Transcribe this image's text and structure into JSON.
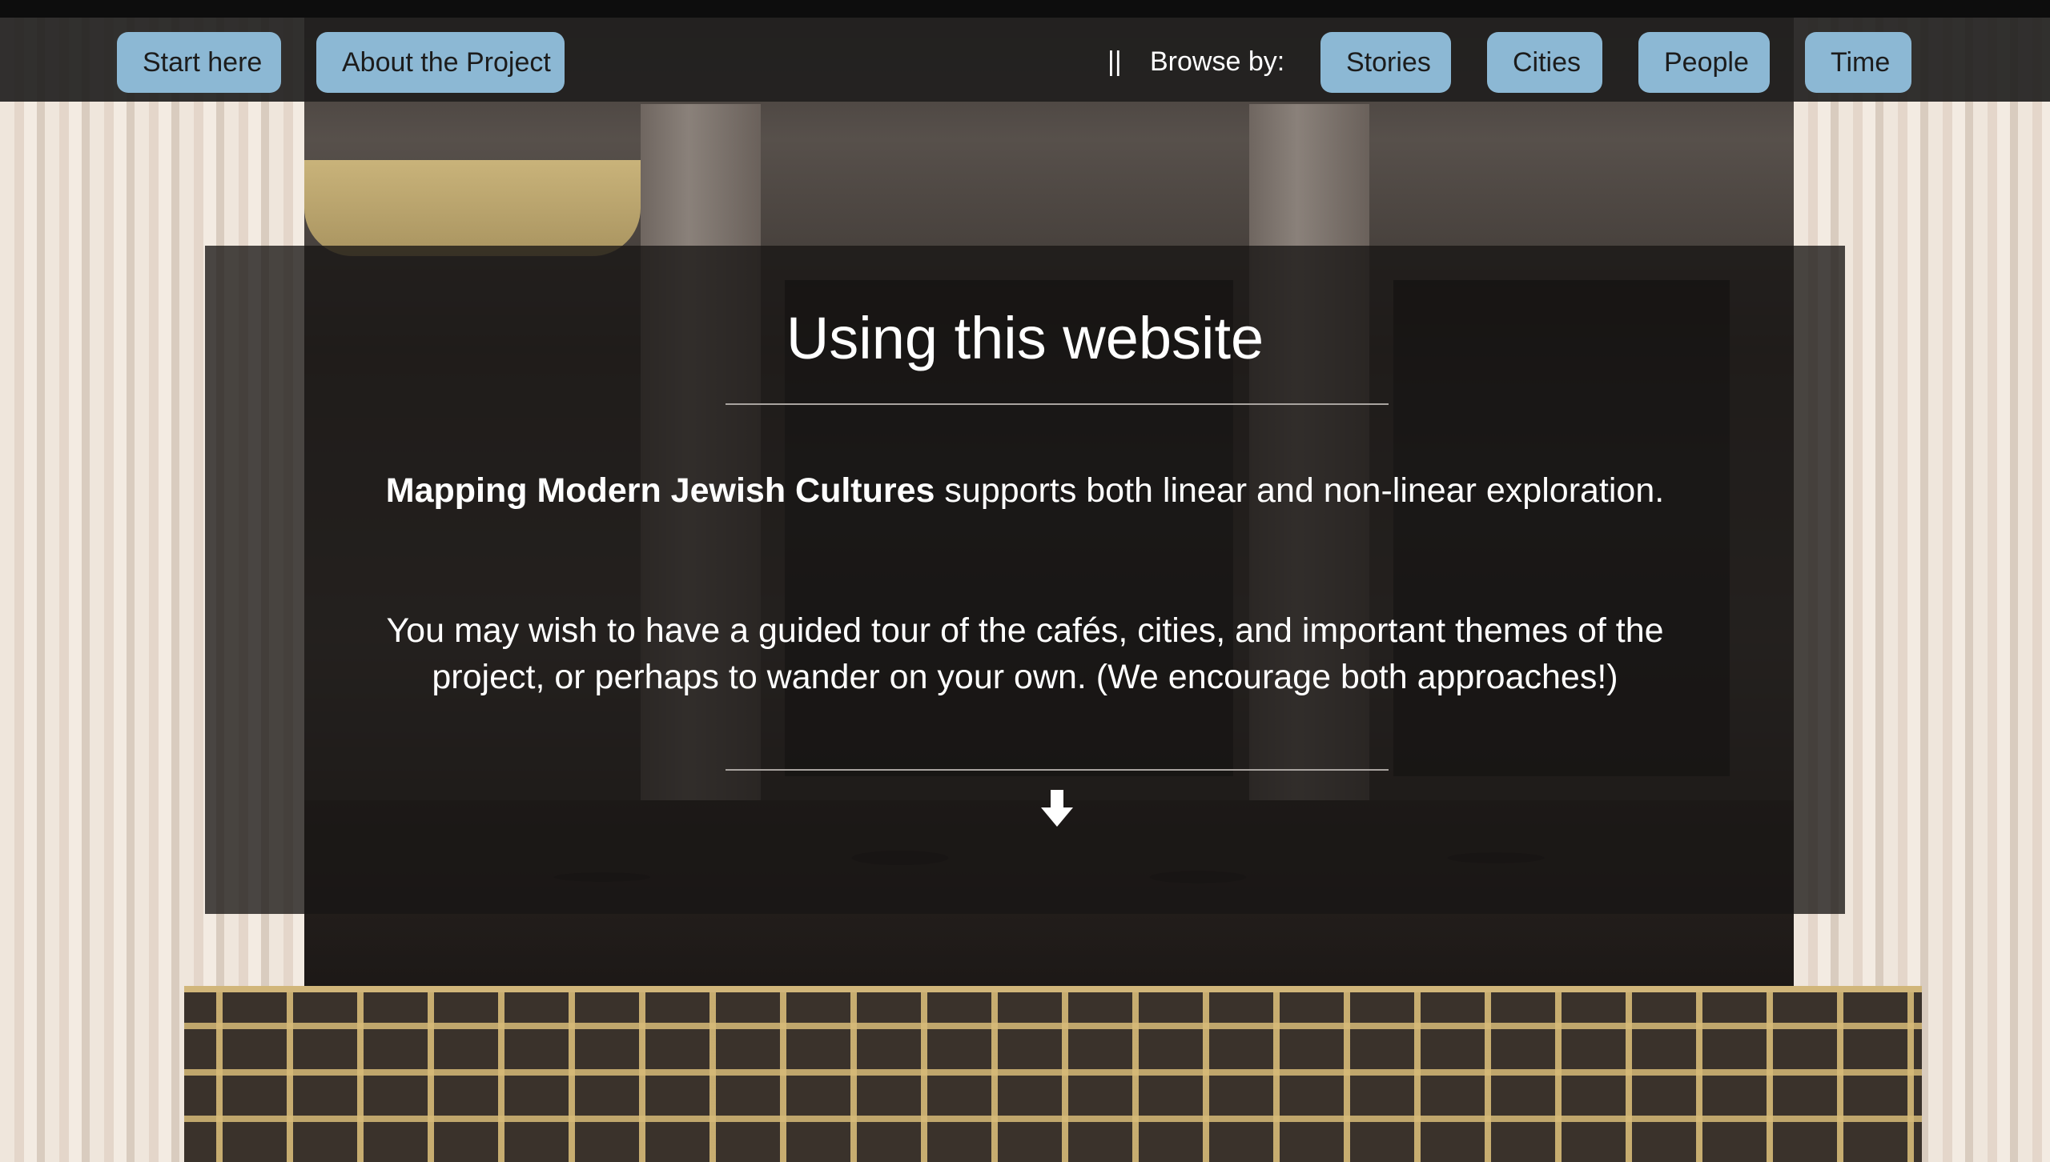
{
  "nav": {
    "start_here": "Start here",
    "about_project": "About the Project",
    "separator": "||",
    "browse_by_label": "Browse by:",
    "browse_options": [
      "Stories",
      "Cities",
      "People",
      "Time"
    ]
  },
  "main": {
    "title": "Using this website",
    "intro_bold": "Mapping Modern Jewish Cultures",
    "intro_rest": " supports both linear and non-linear exploration.",
    "paragraph": "You may wish to have a guided tour of the cafés, cities, and important themes of the project, or perhaps to wander on your own. (We encourage both approaches!)",
    "scroll_icon": "down-arrow-icon"
  },
  "colors": {
    "nav_button": "#8cb8d4",
    "navbar_bg": "#211f1e",
    "panel_bg": "#181615"
  }
}
